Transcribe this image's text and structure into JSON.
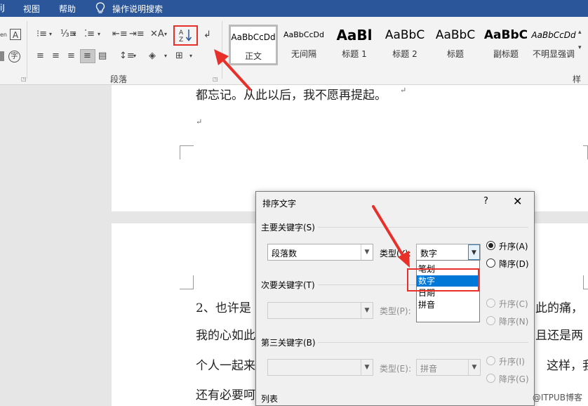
{
  "menu": {
    "item_fragment": "iJ",
    "view": "视图",
    "help": "帮助",
    "tell_me": "操作说明搜索"
  },
  "ribbon": {
    "paragraph_group_label": "段落",
    "styles_group_label_fragment": "样式",
    "styles": [
      {
        "preview": "AaBbCcDd",
        "name": "正文",
        "active": true
      },
      {
        "preview": "AaBbCcDd",
        "name": "无间隔",
        "active": false
      },
      {
        "preview": "AaBl",
        "name": "标题 1",
        "active": false
      },
      {
        "preview": "AaBbC",
        "name": "标题 2",
        "active": false
      },
      {
        "preview": "AaBbC",
        "name": "标题",
        "active": false
      },
      {
        "preview": "AaBbC",
        "name": "副标题",
        "active": false
      },
      {
        "preview": "AaBbCcDd",
        "name": "不明显强调",
        "active": false
      }
    ]
  },
  "document": {
    "line1": "都忘记。从此以后，我不愿再提起。",
    "line2_left": "2、也许是",
    "line2_right": "此的痛，",
    "line3_left": "我的心如此",
    "line3_right": "且还是两",
    "line4_left": "个人一起来",
    "line4_right": "这样，我",
    "line5_left": "还有必要呵"
  },
  "dialog": {
    "title": "排序文字",
    "help": "?",
    "close": "✕",
    "primary_key_label": "主要关键字(S)",
    "primary_key_value": "段落数",
    "type_label": "类型(Y):",
    "type_value": "数字",
    "ascending": "升序(A)",
    "descending": "降序(D)",
    "secondary_key_label": "次要关键字(T)",
    "secondary_type_label": "类型(P):",
    "secondary_ascending": "升序(C)",
    "secondary_descending": "降序(N)",
    "tertiary_key_label": "第三关键字(B)",
    "tertiary_type_label": "类型(E):",
    "tertiary_type_value": "拼音",
    "tertiary_ascending": "升序(I)",
    "tertiary_descending": "降序(G)",
    "list_label": "列表"
  },
  "dropdown": {
    "options": [
      "笔划",
      "数字",
      "日期",
      "拼音"
    ],
    "selected": "数字"
  },
  "watermark": "@ITPUB博客",
  "colors": {
    "title_bar": "#2b579a",
    "highlight": "#0078d7",
    "annotation_red": "#e8302a"
  }
}
